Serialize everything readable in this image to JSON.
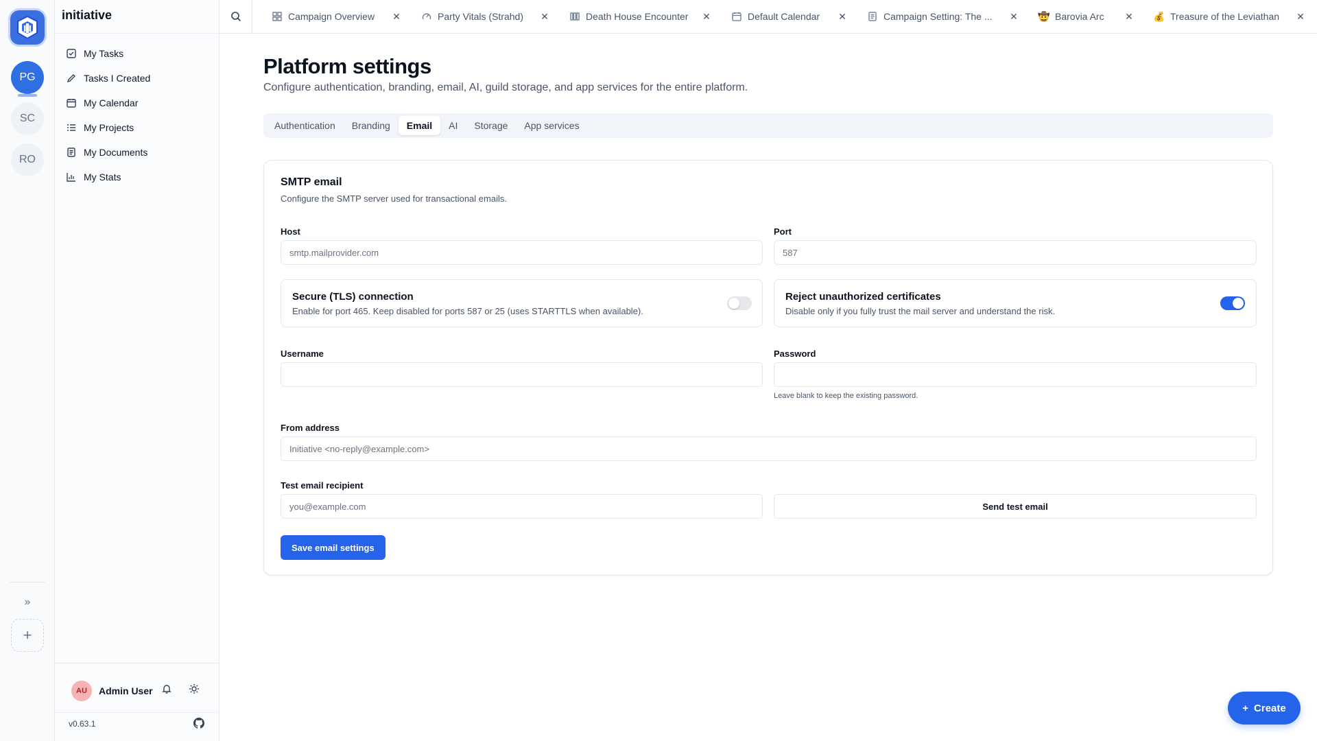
{
  "app": {
    "brand": "initiative",
    "version": "v0.63.1"
  },
  "rail": {
    "guilds": [
      {
        "initials": "PG",
        "active": true
      },
      {
        "initials": "SC",
        "active": false
      },
      {
        "initials": "RO",
        "active": false
      }
    ]
  },
  "sidebar": {
    "items": [
      {
        "label": "My Tasks",
        "icon": "check-square-icon"
      },
      {
        "label": "Tasks I Created",
        "icon": "pencil-icon"
      },
      {
        "label": "My Calendar",
        "icon": "calendar-icon"
      },
      {
        "label": "My Projects",
        "icon": "list-icon"
      },
      {
        "label": "My Documents",
        "icon": "document-icon"
      },
      {
        "label": "My Stats",
        "icon": "bar-chart-icon"
      }
    ],
    "user": {
      "initials": "AU",
      "name": "Admin User"
    }
  },
  "tabs": [
    {
      "label": "Campaign Overview",
      "icon": "grid-icon"
    },
    {
      "label": "Party Vitals (Strahd)",
      "icon": "gauge-icon"
    },
    {
      "label": "Death House Encounter",
      "icon": "board-icon"
    },
    {
      "label": "Default Calendar",
      "icon": "calendar-icon"
    },
    {
      "label": "Campaign Setting: The ...",
      "icon": "document-icon"
    },
    {
      "label": "Barovia Arc",
      "icon": "emoji-cowboy-icon",
      "glyph": "🤠"
    },
    {
      "label": "Treasure of the Leviathan",
      "icon": "emoji-moneybag-icon",
      "glyph": "💰"
    }
  ],
  "page": {
    "title": "Platform settings",
    "subtitle": "Configure authentication, branding, email, AI, guild storage, and app services for the entire platform.",
    "settings_tabs": [
      {
        "label": "Authentication",
        "active": false
      },
      {
        "label": "Branding",
        "active": false
      },
      {
        "label": "Email",
        "active": true
      },
      {
        "label": "AI",
        "active": false
      },
      {
        "label": "Storage",
        "active": false
      },
      {
        "label": "App services",
        "active": false
      }
    ]
  },
  "smtp": {
    "title": "SMTP email",
    "subtitle": "Configure the SMTP server used for transactional emails.",
    "host": {
      "label": "Host",
      "value": "",
      "placeholder": "smtp.mailprovider.com"
    },
    "port": {
      "label": "Port",
      "value": "",
      "placeholder": "587"
    },
    "tls": {
      "title": "Secure (TLS) connection",
      "description": "Enable for port 465. Keep disabled for ports 587 or 25 (uses STARTTLS when available).",
      "enabled": false
    },
    "reject_unauthorized": {
      "title": "Reject unauthorized certificates",
      "description": "Disable only if you fully trust the mail server and understand the risk.",
      "enabled": true
    },
    "username": {
      "label": "Username",
      "value": "",
      "placeholder": ""
    },
    "password": {
      "label": "Password",
      "value": "",
      "placeholder": "",
      "help": "Leave blank to keep the existing password."
    },
    "from_address": {
      "label": "From address",
      "value": "",
      "placeholder": "Initiative <no-reply@example.com>"
    },
    "test_recipient": {
      "label": "Test email recipient",
      "value": "",
      "placeholder": "you@example.com"
    },
    "send_test_label": "Send test email",
    "save_label": "Save email settings"
  },
  "fab": {
    "label": "Create"
  },
  "colors": {
    "accent": "#2563eb",
    "guild_active": "#2f6fe4",
    "avatar_bg": "#f7b3b3"
  }
}
